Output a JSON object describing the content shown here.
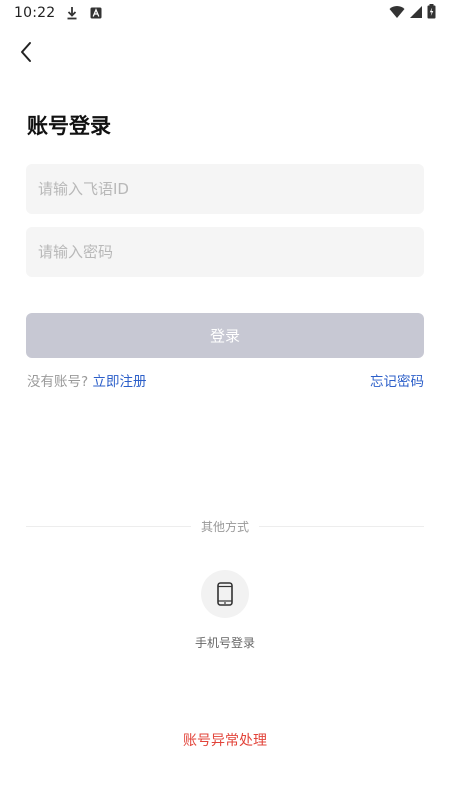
{
  "status_bar": {
    "time": "10:22",
    "left_icons": [
      "download-icon",
      "a-badge-icon"
    ],
    "right_icons": [
      "wifi-icon",
      "signal-icon",
      "battery-icon"
    ]
  },
  "header": {
    "back_icon": "chevron-left-icon",
    "title": "账号登录"
  },
  "form": {
    "id_placeholder": "请输入飞语ID",
    "id_value": "",
    "password_placeholder": "请输入密码",
    "password_value": "",
    "login_label": "登录"
  },
  "register": {
    "no_account_text": "没有账号?",
    "register_link": "立即注册",
    "forgot_link": "忘记密码"
  },
  "other_methods": {
    "divider_text": "其他方式",
    "phone_icon": "smartphone-icon",
    "phone_login_label": "手机号登录"
  },
  "footer": {
    "abnormal_label": "账号异常处理"
  },
  "colors": {
    "link_blue": "#2c5fc9",
    "button_disabled": "#c7c8d3",
    "input_bg": "#f5f5f5",
    "danger_red": "#e2443a"
  }
}
